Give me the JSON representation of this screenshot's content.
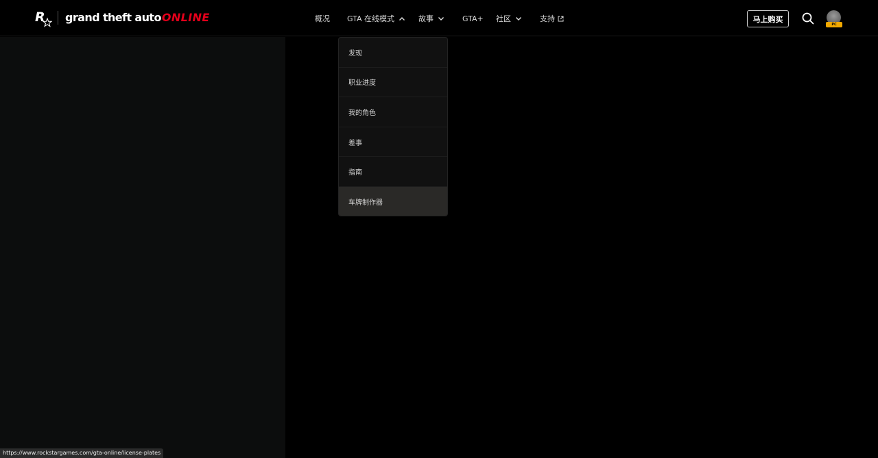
{
  "header": {
    "logo_icon": "rockstar-r-star-icon",
    "logo_text_main": "grand theft auto",
    "logo_text_accent": "ONLINE",
    "nav": [
      {
        "label": "概况"
      },
      {
        "label": "GTA 在线模式",
        "icon": "chevron-up-icon"
      },
      {
        "label": "故事",
        "icon": "chevron-down-icon"
      },
      {
        "label": "GTA+"
      },
      {
        "label": "社区",
        "icon": "chevron-down-icon"
      },
      {
        "label": "支持",
        "icon": "external-link-icon"
      }
    ],
    "buy_label": "马上购买",
    "search_icon": "search-icon",
    "platform_badge": "PC"
  },
  "dropdown": {
    "items": [
      {
        "label": "发现"
      },
      {
        "label": "职业进度"
      },
      {
        "label": "我的角色"
      },
      {
        "label": "差事"
      },
      {
        "label": "指南"
      },
      {
        "label": "车牌制作器",
        "active": true
      }
    ]
  },
  "status_url": "https://www.rockstargames.com/gta-online/license-plates",
  "colors": {
    "background": "#000000",
    "accent_red": "#e3001b",
    "badge_yellow": "#f2a900",
    "panel": "#0c0d0d",
    "dropdown_active": "#2a2927"
  }
}
